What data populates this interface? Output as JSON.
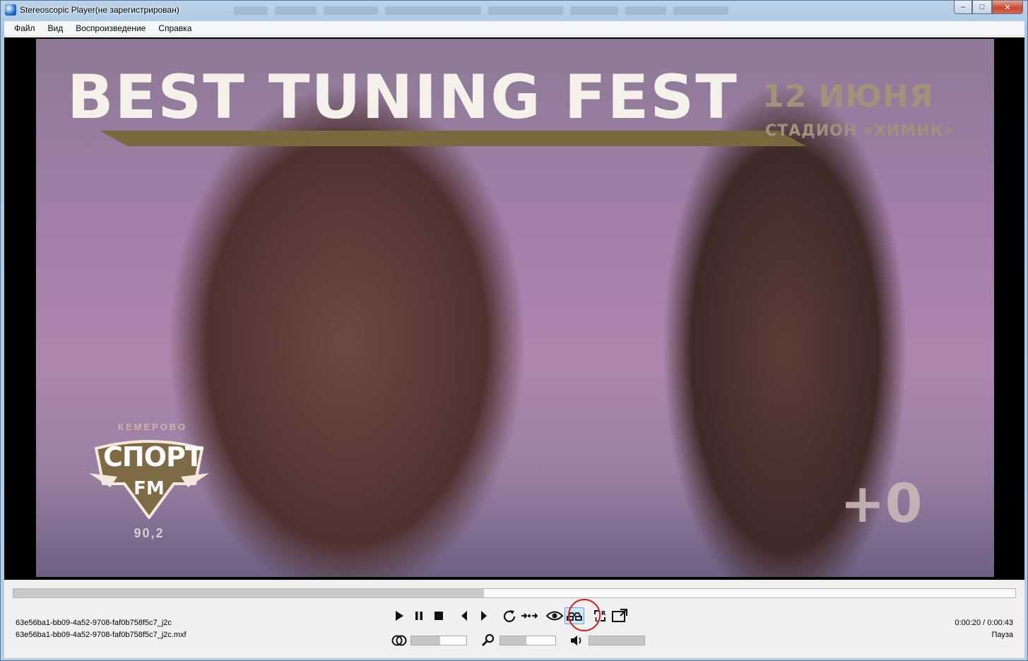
{
  "window": {
    "title": "Stereoscopic Player(не зарегистрирован)",
    "controls": {
      "minimize": "‒",
      "maximize": "□",
      "close": "✕"
    }
  },
  "menu": [
    {
      "label": "Файл"
    },
    {
      "label": "Вид"
    },
    {
      "label": "Воспроизведение"
    },
    {
      "label": "Справка"
    }
  ],
  "video": {
    "headline": "BEST TUNING FEST",
    "date": "12 ИЮНЯ",
    "venue": "СТАДИОН «ХИМИК»",
    "logo": {
      "city": "КЕМЕРОВО",
      "name": "СПОРТ",
      "brand": "FM",
      "frequency": "90,2"
    },
    "age_rating": "+0"
  },
  "playback": {
    "progress": 0.47,
    "file_name": "63e56ba1-bb09-4a52-9708-faf0b758f5c7_j2c",
    "file_path": "63e56ba1-bb09-4a52-9708-faf0b758f5c7_j2c.mxf",
    "time": "0:00:20 / 0:00:43",
    "status": "Пауза",
    "parallax_level": 0.52,
    "zoom_level": 0.47,
    "volume_level": 0.0
  },
  "colors": {
    "highlight_ring": "#d21f26",
    "active_button": "#cde6f7"
  },
  "icons": [
    "play-icon",
    "pause-icon",
    "stop-icon",
    "previous-icon",
    "next-icon",
    "repeat-icon",
    "swap-views-icon",
    "eye-icon",
    "stereo-glasses-icon",
    "swap-lr-icon",
    "fullscreen-icon",
    "parallax-icon",
    "zoom-icon",
    "volume-icon"
  ]
}
